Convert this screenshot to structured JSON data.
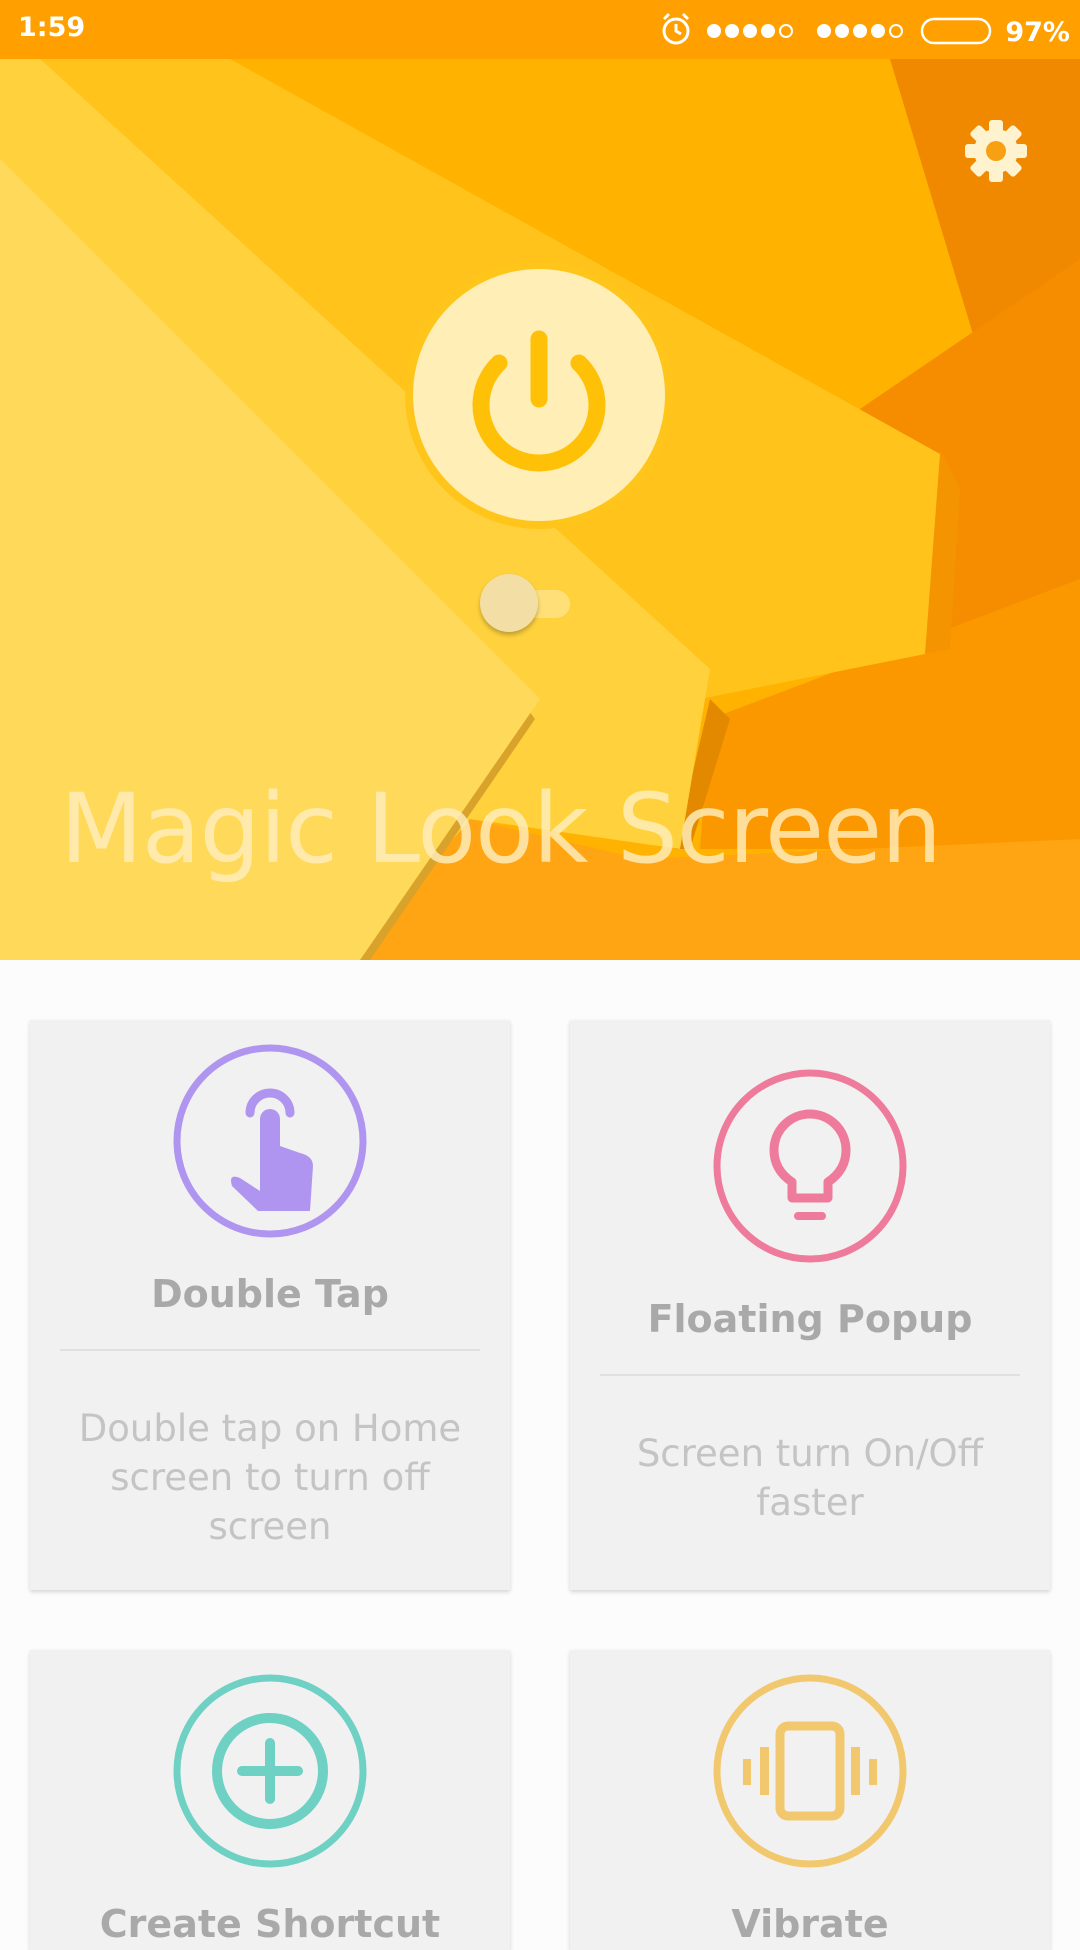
{
  "status_bar": {
    "time": "1:59",
    "battery_percent": "97%",
    "battery_level": 0.97,
    "icons": [
      "alarm-icon",
      "signal-sim1-icon",
      "signal-sim2-icon",
      "battery-icon"
    ]
  },
  "hero": {
    "title": "Magic Look Screen",
    "power_icon": "power-icon",
    "settings_icon": "gear-icon",
    "toggle_on": false
  },
  "cards": [
    {
      "title": "Double Tap",
      "description": "Double tap on Home screen to turn off screen",
      "icon": "finger-tap-icon",
      "color": "#b095f0"
    },
    {
      "title": "Floating Popup",
      "description": "Screen turn On/Off faster",
      "icon": "lightbulb-icon",
      "color": "#ef7b9c"
    },
    {
      "title": "Create Shortcut",
      "description": "",
      "icon": "add-circle-icon",
      "color": "#6fd0c4"
    },
    {
      "title": "Vibrate",
      "description": "",
      "icon": "vibrate-icon",
      "color": "#f2c86e"
    }
  ],
  "colors": {
    "status_bar": "#ffa000",
    "hero_primary": "#ffc107",
    "hero_accent": "#ff9800",
    "card_background": "#f1f1f1"
  }
}
